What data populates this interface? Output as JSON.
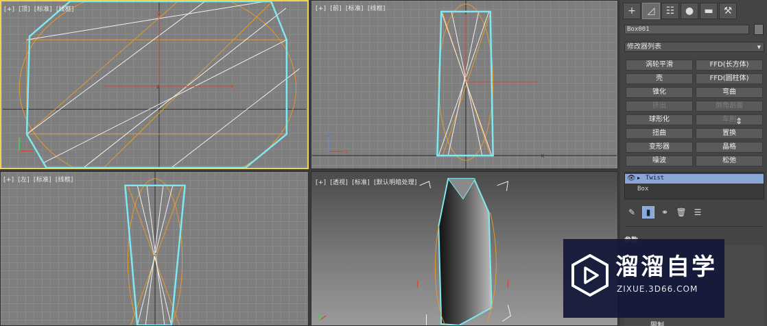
{
  "viewports": {
    "top": {
      "labels": [
        "[+]",
        "[顶]",
        "[标准]",
        "[线框]"
      ]
    },
    "front": {
      "labels": [
        "[+]",
        "[前]",
        "[标准]",
        "[线框]"
      ]
    },
    "left": {
      "labels": [
        "[+]",
        "[左]",
        "[标准]",
        "[线框]"
      ]
    },
    "persp": {
      "labels": [
        "[+]",
        "[透视]",
        "[标准]",
        "[默认明暗处理]"
      ]
    },
    "axis_labels": {
      "x": "x",
      "y": "y",
      "z": "z"
    }
  },
  "panel": {
    "tabs": [
      {
        "icon": "create-icon"
      },
      {
        "icon": "modify-icon"
      },
      {
        "icon": "hierarchy-icon"
      },
      {
        "icon": "motion-icon"
      },
      {
        "icon": "display-icon"
      },
      {
        "icon": "utilities-icon"
      }
    ],
    "object_name": "Box001",
    "modifier_list": "修改器列表",
    "modifiers": [
      {
        "label": "涡轮平滑",
        "enabled": true
      },
      {
        "label": "FFD(长方体)",
        "enabled": true
      },
      {
        "label": "壳",
        "enabled": true
      },
      {
        "label": "FFD(圆柱体)",
        "enabled": true
      },
      {
        "label": "锥化",
        "enabled": true
      },
      {
        "label": "弯曲",
        "enabled": true
      },
      {
        "label": "挤出",
        "enabled": false
      },
      {
        "label": "倒角剖面",
        "enabled": false
      },
      {
        "label": "球形化",
        "enabled": true
      },
      {
        "label": "车削",
        "enabled": false
      },
      {
        "label": "扭曲",
        "enabled": true
      },
      {
        "label": "置换",
        "enabled": true
      },
      {
        "label": "变形器",
        "enabled": true
      },
      {
        "label": "晶格",
        "enabled": true
      },
      {
        "label": "噪波",
        "enabled": true
      },
      {
        "label": "松弛",
        "enabled": true
      }
    ],
    "stack": {
      "selected": "Twist",
      "base": "Box"
    },
    "rollout_title": "参数",
    "bottom_label": "限制"
  },
  "watermark": {
    "title": "溜溜自学",
    "url": "ZIXUE.3D66.COM"
  },
  "colors": {
    "selection": "#7fe9f3",
    "gizmo": "#e89a2c",
    "wire": "#f2f2f2",
    "active_border": "#f1d44f"
  }
}
